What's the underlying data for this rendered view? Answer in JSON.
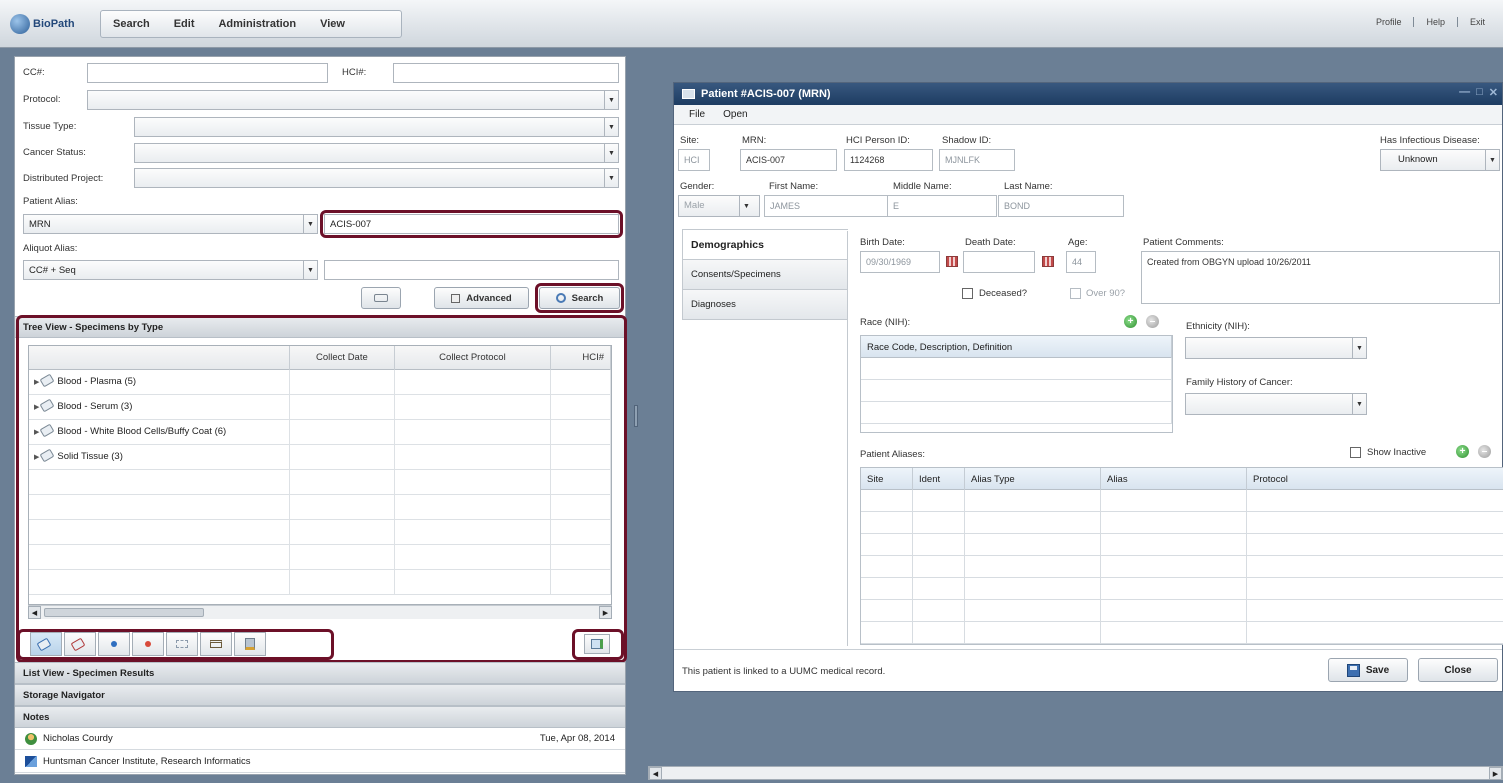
{
  "app": {
    "logo_text": "BioPath"
  },
  "menu": [
    "Search",
    "Edit",
    "Administration",
    "View"
  ],
  "top_links": [
    "Profile",
    "Help",
    "Exit"
  ],
  "search_form": {
    "cc_label": "CC#:",
    "hci_label": "HCI#:",
    "protocol_label": "Protocol:",
    "tissue_type_label": "Tissue Type:",
    "cancer_status_label": "Cancer Status:",
    "distributed_project_label": "Distributed Project:",
    "patient_alias_label": "Patient Alias:",
    "patient_alias_type": "MRN",
    "patient_alias_value": "ACIS-007",
    "aliquot_alias_label": "Aliquot Alias:",
    "aliquot_alias_type": "CC# + Seq",
    "advanced_label": "Advanced",
    "search_label": "Search"
  },
  "tree_view": {
    "title": "Tree View - Specimens by Type",
    "columns": [
      "",
      "Collect Date",
      "Collect Protocol",
      "HCI#"
    ],
    "rows": [
      "Blood - Plasma (5)",
      "Blood - Serum (3)",
      "Blood - White Blood Cells/Buffy Coat (6)",
      "Solid Tissue (3)"
    ]
  },
  "sections": [
    "List View - Specimen Results",
    "Storage Navigator",
    "Notes"
  ],
  "footer": {
    "user_name": "Nicholas Courdy",
    "date": "Tue, Apr 08, 2014",
    "organization": "Huntsman Cancer Institute, Research Informatics"
  },
  "patient_window": {
    "title": "Patient #ACIS-007 (MRN)",
    "menu": [
      "File",
      "Open"
    ],
    "site_label": "Site:",
    "site": "HCI",
    "mrn_label": "MRN:",
    "mrn": "ACIS-007",
    "hci_person_id_label": "HCI Person ID:",
    "hci_person_id": "1124268",
    "shadow_id_label": "Shadow ID:",
    "shadow_id": "MJNLFK",
    "infectious_label": "Has Infectious Disease:",
    "infectious_value": "Unknown",
    "gender_label": "Gender:",
    "gender": "Male",
    "first_name_label": "First Name:",
    "first_name": "JAMES",
    "middle_name_label": "Middle Name:",
    "middle_name": "E",
    "last_name_label": "Last Name:",
    "last_name": "BOND",
    "tabs": [
      "Demographics",
      "Consents/Specimens",
      "Diagnoses"
    ],
    "birth_date_label": "Birth Date:",
    "birth_date": "09/30/1969",
    "death_date_label": "Death Date:",
    "age_label": "Age:",
    "age": "44",
    "deceased_label": "Deceased?",
    "over90_label": "Over 90?",
    "comments_label": "Patient Comments:",
    "comments": "Created from OBGYN upload 10/26/2011",
    "race_label": "Race (NIH):",
    "race_column": "Race Code, Description, Definition",
    "ethnicity_label": "Ethnicity (NIH):",
    "family_history_label": "Family History of Cancer:",
    "aliases_label": "Patient Aliases:",
    "show_inactive_label": "Show Inactive",
    "alias_columns": [
      "Site",
      "Ident",
      "Alias Type",
      "Alias",
      "Protocol"
    ],
    "footer_text": "This patient is linked to a UUMC medical record.",
    "save_label": "Save",
    "close_label": "Close"
  },
  "colors": {
    "highlight": "#6c1028",
    "title_bar": "#1d3c62",
    "background": "#6b7f95"
  }
}
